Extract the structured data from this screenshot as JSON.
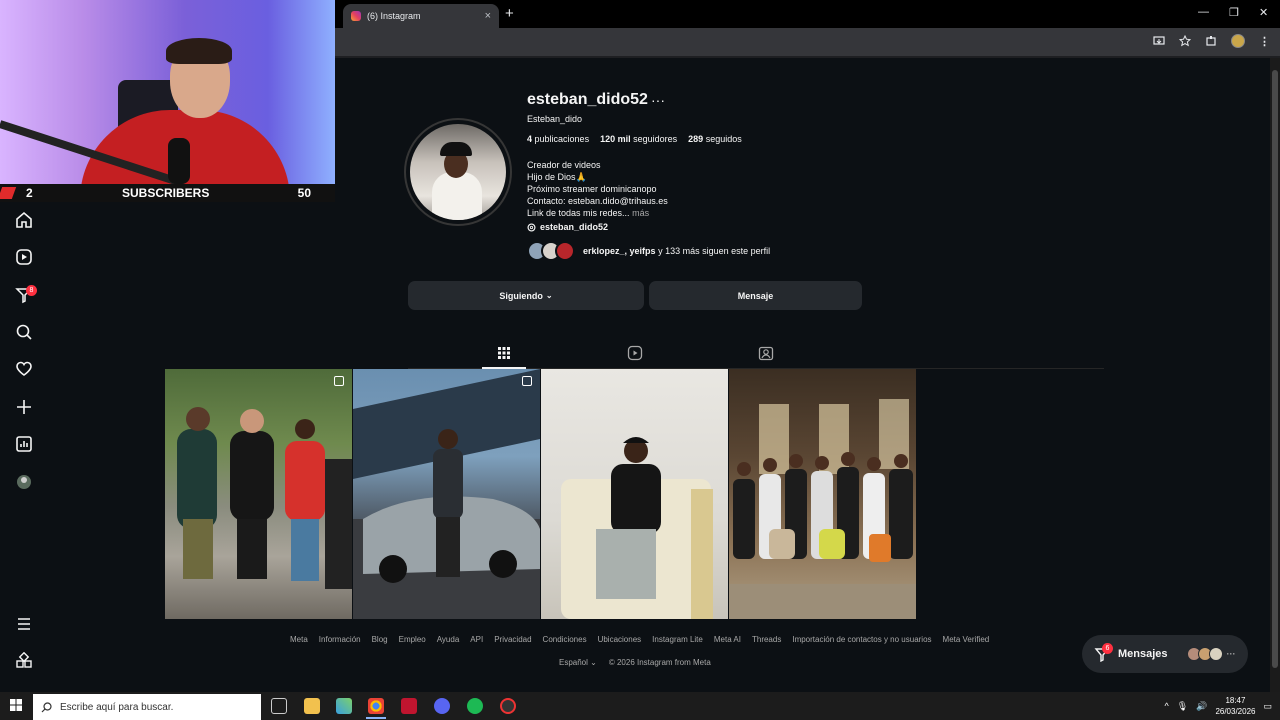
{
  "browser": {
    "tab_title": "(6) Instagram",
    "tab_close": "×",
    "new_tab": "+",
    "win_min": "—",
    "win_restore": "❐",
    "win_close": "✕"
  },
  "overlay": {
    "sub_count_left": "2",
    "sub_label": "SUBSCRIBERS",
    "sub_goal": "50"
  },
  "nav": {
    "notifications_badge": "8",
    "icons": [
      "home-icon",
      "reels-icon",
      "explore-icon",
      "search-icon",
      "notifications-icon",
      "create-icon",
      "dashboard-icon",
      "profile-icon",
      "menu-icon",
      "more-icon"
    ]
  },
  "profile": {
    "username": "esteban_dido52",
    "more": "···",
    "full_name": "Esteban_dido",
    "posts_count": "4",
    "posts_label": "publicaciones",
    "followers_count": "120 mil",
    "followers_label": "seguidores",
    "following_count": "289",
    "following_label": "seguidos",
    "bio": {
      "line1": "Creador de videos",
      "line2": "Hijo de Dios🙏",
      "line3": "Próximo streamer dominicanopo",
      "line4": "Contacto: esteban.dido@trihaus.es",
      "line5": "Link de todas mis redes...",
      "more": "más"
    },
    "threads_handle": "esteban_dido52",
    "followed_by_names": "erklopez_, yeifps",
    "followed_by_rest": "y 133 más siguen este perfil"
  },
  "actions": {
    "following_button": "Siguiendo",
    "message_button": "Mensaje"
  },
  "footer": {
    "links": [
      "Meta",
      "Información",
      "Blog",
      "Empleo",
      "Ayuda",
      "API",
      "Privacidad",
      "Condiciones",
      "Ubicaciones",
      "Instagram Lite",
      "Meta AI",
      "Threads",
      "Importación de contactos y no usuarios",
      "Meta Verified"
    ],
    "language": "Español",
    "copyright": "© 2026 Instagram from Meta"
  },
  "messages": {
    "label": "Mensajes",
    "badge": "6",
    "more": "···"
  },
  "taskbar": {
    "search_placeholder": "Escribe aquí para buscar.",
    "time": "18:47",
    "date": "26/03/2026"
  },
  "colors": {
    "background": "#0c1014",
    "button": "#25292e",
    "badge": "#ff3040",
    "muted_text": "#a8a8a8"
  }
}
